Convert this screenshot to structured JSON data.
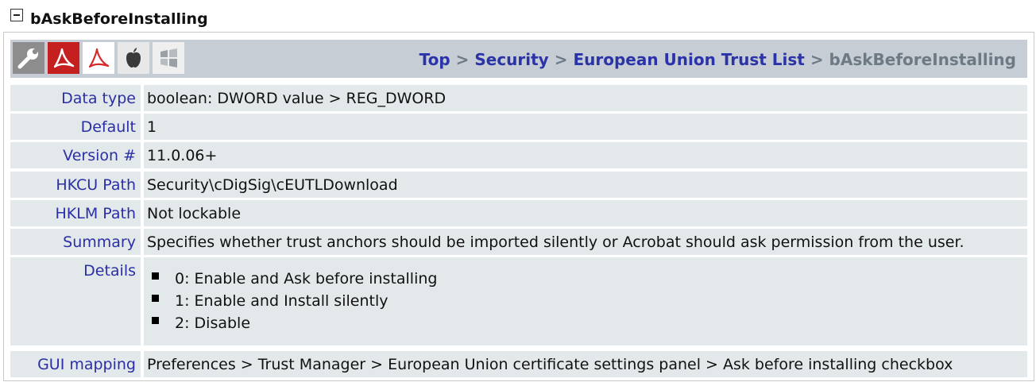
{
  "header": {
    "title": "bAskBeforeInstalling"
  },
  "toolbar": {
    "icons": [
      "wrench-icon",
      "acrobat-red-icon",
      "acrobat-outline-icon",
      "apple-icon",
      "windows-icon"
    ]
  },
  "breadcrumb": {
    "items": [
      "Top",
      "Security",
      "European Union Trust List"
    ],
    "separator": ">",
    "current": "bAskBeforeInstalling"
  },
  "rows": {
    "data_type": {
      "label": "Data type",
      "value": "boolean: DWORD value > REG_DWORD"
    },
    "default": {
      "label": "Default",
      "value": "1"
    },
    "version": {
      "label": "Version #",
      "value": "11.0.06+"
    },
    "hkcu": {
      "label": "HKCU Path",
      "value": "Security\\cDigSig\\cEUTLDownload"
    },
    "hklm": {
      "label": "HKLM Path",
      "value": "Not lockable"
    },
    "summary": {
      "label": "Summary",
      "value": "Specifies whether trust anchors should be imported silently or Acrobat should ask permission from the user."
    },
    "details": {
      "label": "Details",
      "items": [
        "0: Enable and Ask before installing",
        "1: Enable and Install silently",
        "2: Disable"
      ]
    },
    "gui": {
      "label": "GUI mapping",
      "value": "Preferences > Trust Manager > European Union certificate settings panel > Ask before installing checkbox"
    }
  },
  "colors": {
    "link": "#2b33a8",
    "row_bg": "#e3e9ea",
    "topbar_bg": "#c6cdd4",
    "current_crumb": "#6d7a86"
  }
}
